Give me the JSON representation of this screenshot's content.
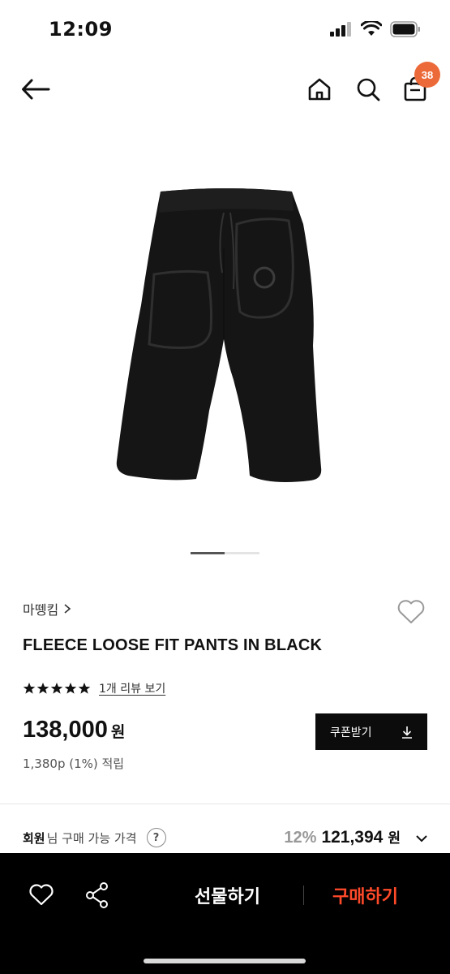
{
  "status_bar": {
    "time": "12:09"
  },
  "header": {
    "icons": [
      "back-arrow-icon",
      "home-icon",
      "search-icon",
      "shopping-bag-icon"
    ],
    "cart_count": "38",
    "badge_color": "#ec6a3a"
  },
  "gallery": {
    "current_index": 1,
    "total": 2
  },
  "product": {
    "brand": "마뗑킴",
    "name": "FLEECE LOOSE FIT PANTS IN BLACK",
    "rating": 5,
    "max_rating": 5,
    "review_link": "1개 리뷰 보기",
    "price": "138,000",
    "price_unit": "원",
    "points": "1,380p (1%) 적립"
  },
  "coupon": {
    "label": "쿠폰받기"
  },
  "member_price": {
    "label_strong": "회원",
    "label_rest": "님 구매 가능 가격",
    "help": "?",
    "discount": "12%",
    "amount": "121,394",
    "unit": "원"
  },
  "bottom_bar": {
    "gift_label": "선물하기",
    "buy_label": "구매하기",
    "buy_color": "#ff4a2a"
  }
}
